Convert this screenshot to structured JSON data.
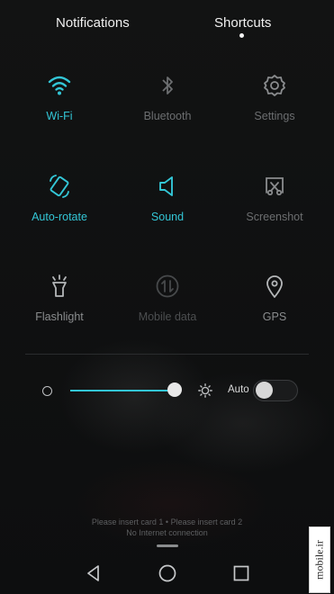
{
  "tabs": {
    "notifications": "Notifications",
    "shortcuts": "Shortcuts",
    "active": "shortcuts"
  },
  "tiles": [
    {
      "label": "Wi-Fi",
      "icon": "wifi-icon",
      "state": "on"
    },
    {
      "label": "Bluetooth",
      "icon": "bluetooth-icon",
      "state": "off"
    },
    {
      "label": "Settings",
      "icon": "settings-icon",
      "state": "off"
    },
    {
      "label": "Auto-rotate",
      "icon": "auto-rotate-icon",
      "state": "on"
    },
    {
      "label": "Sound",
      "icon": "sound-icon",
      "state": "on"
    },
    {
      "label": "Screenshot",
      "icon": "screenshot-icon",
      "state": "off"
    },
    {
      "label": "Flashlight",
      "icon": "flashlight-icon",
      "state": "neutral"
    },
    {
      "label": "Mobile data",
      "icon": "mobile-data-icon",
      "state": "disabled"
    },
    {
      "label": "GPS",
      "icon": "gps-icon",
      "state": "neutral"
    }
  ],
  "brightness": {
    "auto_label": "Auto",
    "auto_enabled": false,
    "level": 1.0
  },
  "status": {
    "sim_text": "Please insert card 1 • Please insert card 2",
    "network_text": "No Internet connection"
  },
  "watermark": "mobile.ir",
  "colors": {
    "accent": "#33c6d6",
    "background": "#0f1011",
    "inactive": "#6c6e70"
  }
}
